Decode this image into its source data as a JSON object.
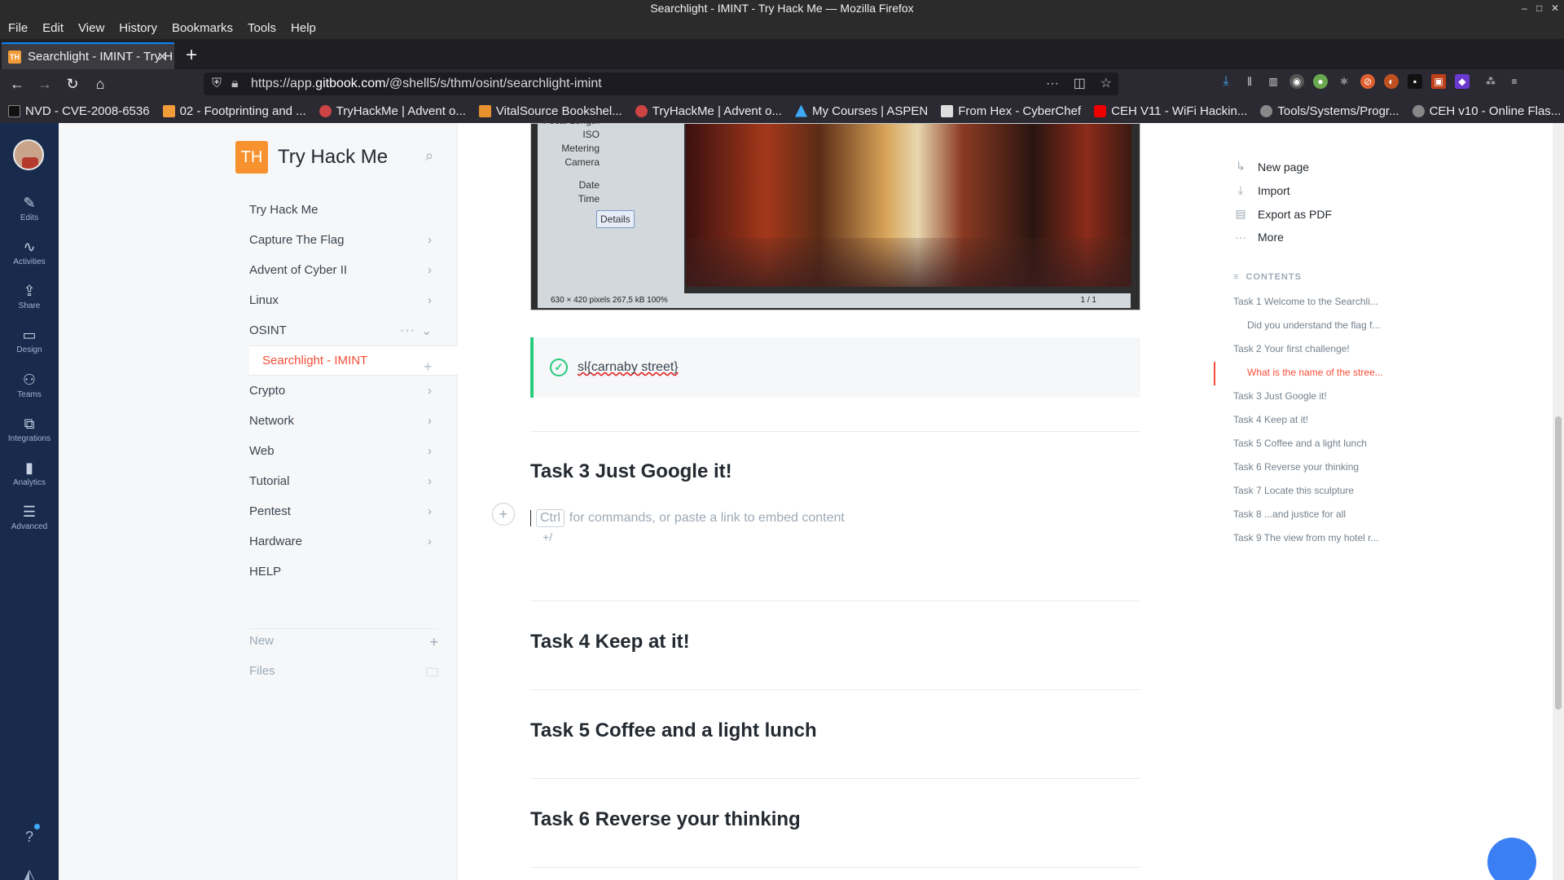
{
  "window": {
    "title": "Searchlight - IMINT - Try Hack Me — Mozilla Firefox"
  },
  "menu": [
    "File",
    "Edit",
    "View",
    "History",
    "Bookmarks",
    "Tools",
    "Help"
  ],
  "tab": {
    "favicon": "TH",
    "label": "Searchlight - IMINT - Try H"
  },
  "url": {
    "prefix": "https://app.",
    "domain": "gitbook.com",
    "path": "/@shell5/s/thm/osint/searchlight-imint"
  },
  "bookmarks": [
    "NVD - CVE-2008-6536",
    "02 - Footprinting and ...",
    "TryHackMe | Advent o...",
    "VitalSource Bookshel...",
    "TryHackMe | Advent o...",
    "My Courses | ASPEN",
    "From Hex - CyberChef",
    "CEH V11 - WiFi Hackin...",
    "Tools/Systems/Progr...",
    "CEH v10 - Online Flas..."
  ],
  "rail": [
    {
      "icon": "pencil-icon",
      "glyph": "✎",
      "label": "Edits"
    },
    {
      "icon": "activity-icon",
      "glyph": "∿",
      "label": "Activities"
    },
    {
      "icon": "share-icon",
      "glyph": "⇪",
      "label": "Share"
    },
    {
      "icon": "design-icon",
      "glyph": "▭",
      "label": "Design"
    },
    {
      "icon": "teams-icon",
      "glyph": "⚇",
      "label": "Teams"
    },
    {
      "icon": "integrations-icon",
      "glyph": "⧉",
      "label": "Integrations"
    },
    {
      "icon": "analytics-icon",
      "glyph": "▮",
      "label": "Analytics"
    },
    {
      "icon": "advanced-icon",
      "glyph": "☰",
      "label": "Advanced"
    }
  ],
  "sidebar": {
    "logo": "TH",
    "title": "Try Hack Me",
    "items": [
      {
        "label": "Try Hack Me",
        "chevron": ""
      },
      {
        "label": "Capture The Flag",
        "chevron": "›"
      },
      {
        "label": "Advent of Cyber II",
        "chevron": "›"
      },
      {
        "label": "Linux",
        "chevron": "›"
      },
      {
        "label": "OSINT",
        "chevron": "⌄"
      },
      {
        "label": "Searchlight - IMINT",
        "chevron": ""
      },
      {
        "label": "Crypto",
        "chevron": "›"
      },
      {
        "label": "Network",
        "chevron": "›"
      },
      {
        "label": "Web",
        "chevron": "›"
      },
      {
        "label": "Tutorial",
        "chevron": "›"
      },
      {
        "label": "Pentest",
        "chevron": "›"
      },
      {
        "label": "Hardware",
        "chevron": "›"
      },
      {
        "label": "HELP",
        "chevron": ""
      }
    ],
    "new_label": "New",
    "files_label": "Files"
  },
  "exif": {
    "rows": [
      "Focal Length",
      "ISO",
      "Metering",
      "Camera",
      "",
      "Date",
      "Time"
    ],
    "details": "Details",
    "status": "630 × 420 pixels  267,5 kB   100%",
    "page": "1 / 1"
  },
  "hint": {
    "text": "sl{carnaby street}"
  },
  "editor": {
    "ctrl": "Ctrl",
    "placeholder": "for commands, or paste a link to embed content",
    "slash": "+/"
  },
  "headings": {
    "task3": "Task 3 Just Google it!",
    "task4": "Task 4 Keep at it!",
    "task5": "Task 5 Coffee and a light lunch",
    "task6": "Task 6 Reverse your thinking"
  },
  "actions": [
    {
      "icon": "new-page-icon",
      "glyph": "↳",
      "label": "New page"
    },
    {
      "icon": "import-icon",
      "glyph": "⤓",
      "label": "Import"
    },
    {
      "icon": "pdf-icon",
      "glyph": "▤",
      "label": "Export as PDF"
    },
    {
      "icon": "more-icon",
      "glyph": "···",
      "label": "More"
    }
  ],
  "contents": {
    "heading": "CONTENTS",
    "items": [
      {
        "label": "Task 1 Welcome to the Searchli...",
        "sub": false,
        "active": false
      },
      {
        "label": "Did you understand the flag f...",
        "sub": true,
        "active": false
      },
      {
        "label": "Task 2 Your first challenge!",
        "sub": false,
        "active": false
      },
      {
        "label": "What is the name of the stree...",
        "sub": true,
        "active": true
      },
      {
        "label": "Task 3 Just Google it!",
        "sub": false,
        "active": false
      },
      {
        "label": "Task 4 Keep at it!",
        "sub": false,
        "active": false
      },
      {
        "label": "Task 5 Coffee and a light lunch",
        "sub": false,
        "active": false
      },
      {
        "label": "Task 6 Reverse your thinking",
        "sub": false,
        "active": false
      },
      {
        "label": "Task 7 Locate this sculpture",
        "sub": false,
        "active": false
      },
      {
        "label": "Task 8 ...and justice for all",
        "sub": false,
        "active": false
      },
      {
        "label": "Task 9 The view from my hotel r...",
        "sub": false,
        "active": false
      }
    ]
  },
  "colors": {
    "accent": "#f74d38",
    "success": "#26cb7c",
    "rail": "#182b4d"
  }
}
